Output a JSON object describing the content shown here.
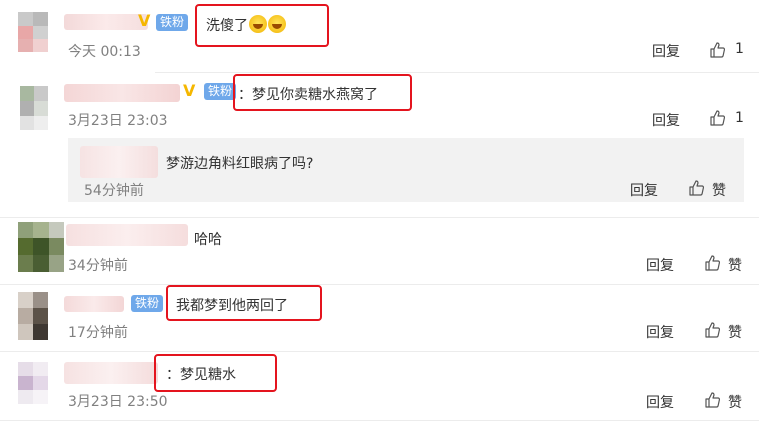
{
  "comments": [
    {
      "badge": "铁粉",
      "text": "洗傻了",
      "emoji_icons": [
        "laugh-cry-emoji",
        "laugh-cry-emoji"
      ],
      "time": "今天 00:13",
      "reply_label": "回复",
      "like_count": "1"
    },
    {
      "badge": "铁粉",
      "text": "：梦见你卖糖水燕窝了",
      "time": "3月23日 23:03",
      "reply_label": "回复",
      "like_count": "1",
      "sub_reply": {
        "text": "梦游边角料红眼病了吗?",
        "time": "54分钟前",
        "reply_label": "回复",
        "like_label": "赞"
      }
    },
    {
      "text": "哈哈",
      "time": "34分钟前",
      "reply_label": "回复",
      "like_label": "赞"
    },
    {
      "badge": "铁粉",
      "text": "我都梦到他两回了",
      "time": "17分钟前",
      "reply_label": "回复",
      "like_label": "赞"
    },
    {
      "text": "：梦见糖水",
      "time": "3月23日 23:50",
      "reply_label": "回复",
      "like_label": "赞"
    }
  ],
  "colors": {
    "highlight_box": "#e4141e",
    "badge": "#6fa8ea",
    "vip_mark": "#f5b700",
    "time_text": "#808080",
    "reply_bg": "#f2f2f2"
  },
  "icons": {
    "like": "thumbs-up-icon",
    "verified": "vip-v-icon"
  }
}
